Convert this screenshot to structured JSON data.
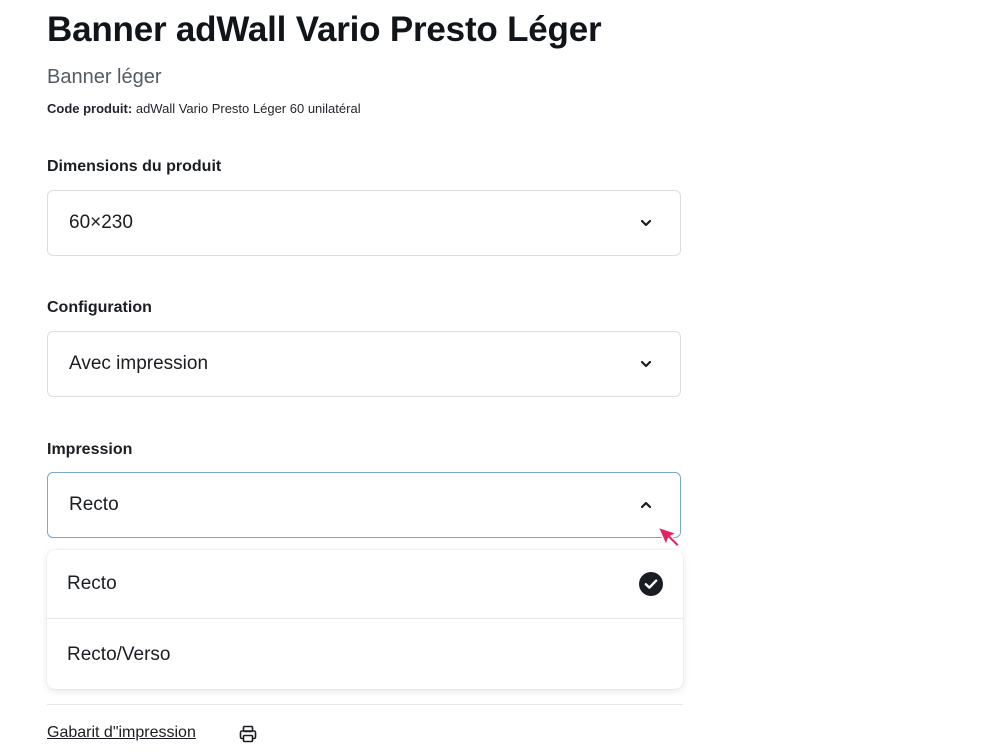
{
  "product": {
    "title": "Banner adWall Vario Presto Léger",
    "subtitle": "Banner léger",
    "code_label": "Code produit:",
    "code_value": "adWall Vario Presto Léger 60 unilatéral"
  },
  "fields": [
    {
      "label": "Dimensions du produit",
      "value": "60×230",
      "state": "closed",
      "icon": "chevron-down-icon"
    },
    {
      "label": "Configuration",
      "value": "Avec impression",
      "state": "closed",
      "icon": "chevron-down-icon"
    },
    {
      "label": "Impression",
      "value": "Recto",
      "state": "open",
      "icon": "chevron-up-icon"
    }
  ],
  "dropdown": {
    "options": [
      {
        "label": "Recto",
        "selected": true
      },
      {
        "label": "Recto/Verso",
        "selected": false
      }
    ]
  },
  "footer": {
    "template_link": "Gabarit d\"impression",
    "icon": "printer-icon"
  },
  "colors": {
    "text": "#111418",
    "border": "#d9dde2",
    "focus_border": "#7aa8c9",
    "cursor": "#e0245e"
  }
}
